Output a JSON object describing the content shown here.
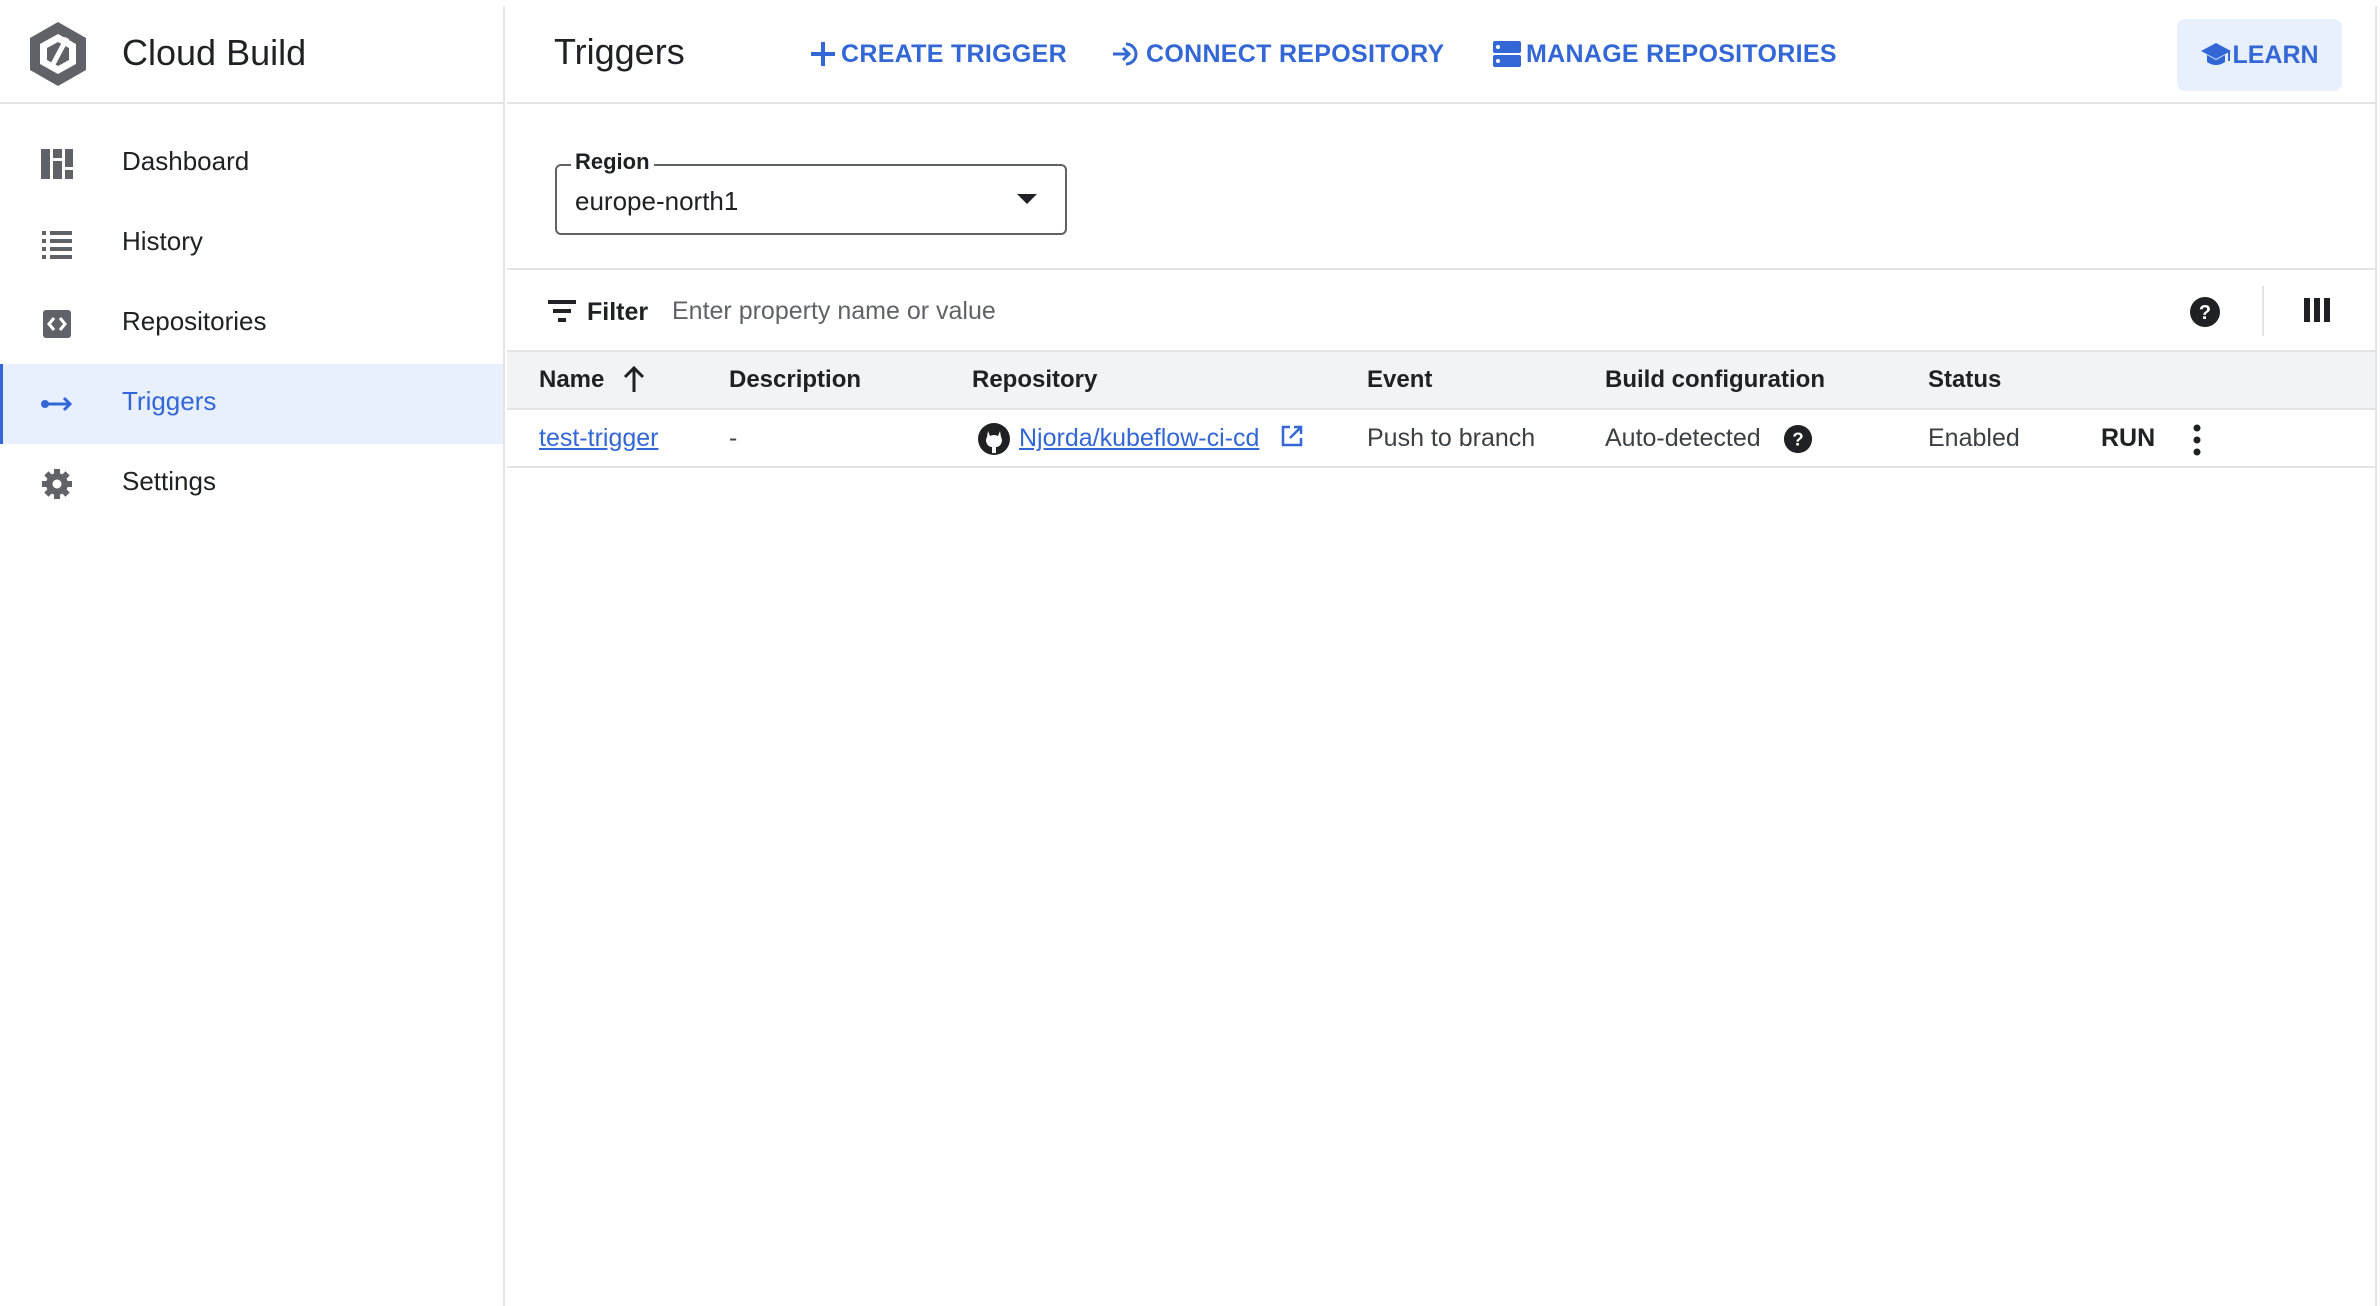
{
  "app": {
    "title": "Cloud Build"
  },
  "sidebar": {
    "items": [
      {
        "label": "Dashboard",
        "icon": "dashboard-icon"
      },
      {
        "label": "History",
        "icon": "list-icon"
      },
      {
        "label": "Repositories",
        "icon": "code-repo-icon"
      },
      {
        "label": "Triggers",
        "icon": "trigger-arrow-icon",
        "active": true
      },
      {
        "label": "Settings",
        "icon": "gear-icon"
      }
    ]
  },
  "header": {
    "title": "Triggers",
    "create_trigger": "CREATE TRIGGER",
    "connect_repository": "CONNECT REPOSITORY",
    "manage_repositories": "MANAGE REPOSITORIES",
    "learn": "LEARN"
  },
  "region": {
    "label": "Region",
    "value": "europe-north1"
  },
  "filter": {
    "label": "Filter",
    "placeholder": "Enter property name or value"
  },
  "table": {
    "columns": [
      "Name",
      "Description",
      "Repository",
      "Event",
      "Build configuration",
      "Status"
    ],
    "rows": [
      {
        "name": "test-trigger",
        "description": "-",
        "repository": "Njorda/kubeflow-ci-cd",
        "event": "Push to branch",
        "build_configuration": "Auto-detected",
        "status": "Enabled",
        "action": "RUN"
      }
    ]
  },
  "colors": {
    "accent": "#3367d6",
    "active_bg": "#e8f0fe",
    "border": "#e3e3e3"
  }
}
